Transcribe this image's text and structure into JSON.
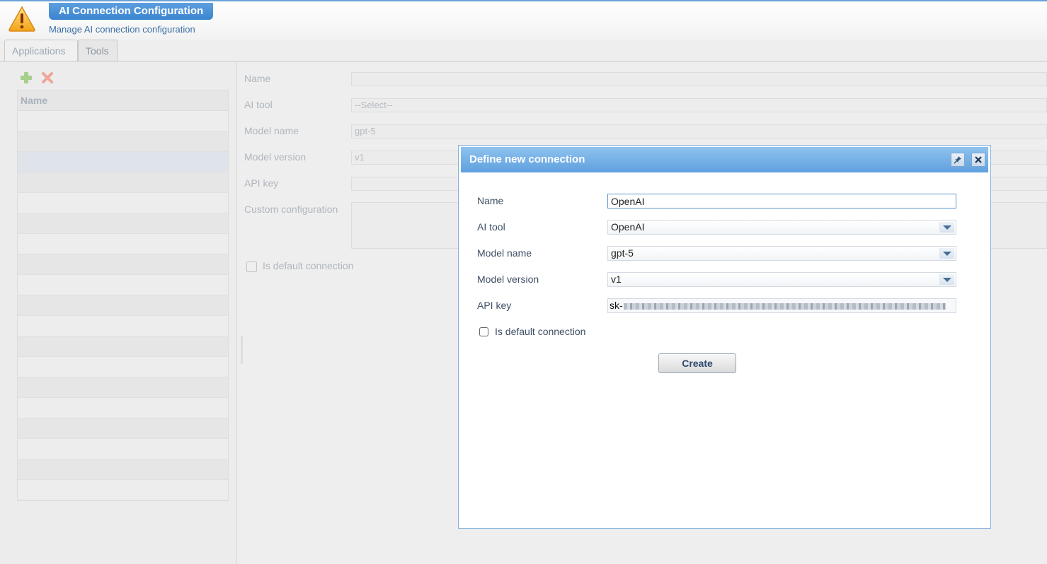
{
  "header": {
    "title": "AI Connection Configuration",
    "subtitle": "Manage AI connection configuration",
    "icon": "warning-icon"
  },
  "tabs": [
    {
      "label": "Applications",
      "active": true
    },
    {
      "label": "Tools",
      "active": false
    }
  ],
  "left_panel": {
    "toolbar": {
      "add_icon": "plus-icon",
      "delete_icon": "close-x-icon"
    },
    "grid": {
      "column_header": "Name",
      "rows": [
        "",
        "",
        "",
        "",
        "",
        "",
        "",
        "",
        "",
        "",
        "",
        "",
        "",
        "",
        "",
        "",
        "",
        "",
        ""
      ]
    }
  },
  "details_form": {
    "name_label": "Name",
    "name_value": "",
    "ai_tool_label": "AI tool",
    "ai_tool_value": "--Select--",
    "model_name_label": "Model name",
    "model_name_value": "gpt-5",
    "model_version_label": "Model version",
    "model_version_value": "v1",
    "api_key_label": "API key",
    "custom_config_label": "Custom configuration",
    "default_label": "Is default connection"
  },
  "dialog": {
    "title": "Define new connection",
    "pin_icon": "pin-icon",
    "close_icon": "close-icon",
    "name_label": "Name",
    "name_value": "OpenAI",
    "ai_tool_label": "AI tool",
    "ai_tool_value": "OpenAI",
    "model_name_label": "Model name",
    "model_name_value": "gpt-5",
    "model_version_label": "Model version",
    "model_version_value": "v1",
    "api_key_label": "API key",
    "api_key_prefix": "sk-",
    "default_label": "Is default connection",
    "default_checked": false,
    "create_label": "Create"
  }
}
